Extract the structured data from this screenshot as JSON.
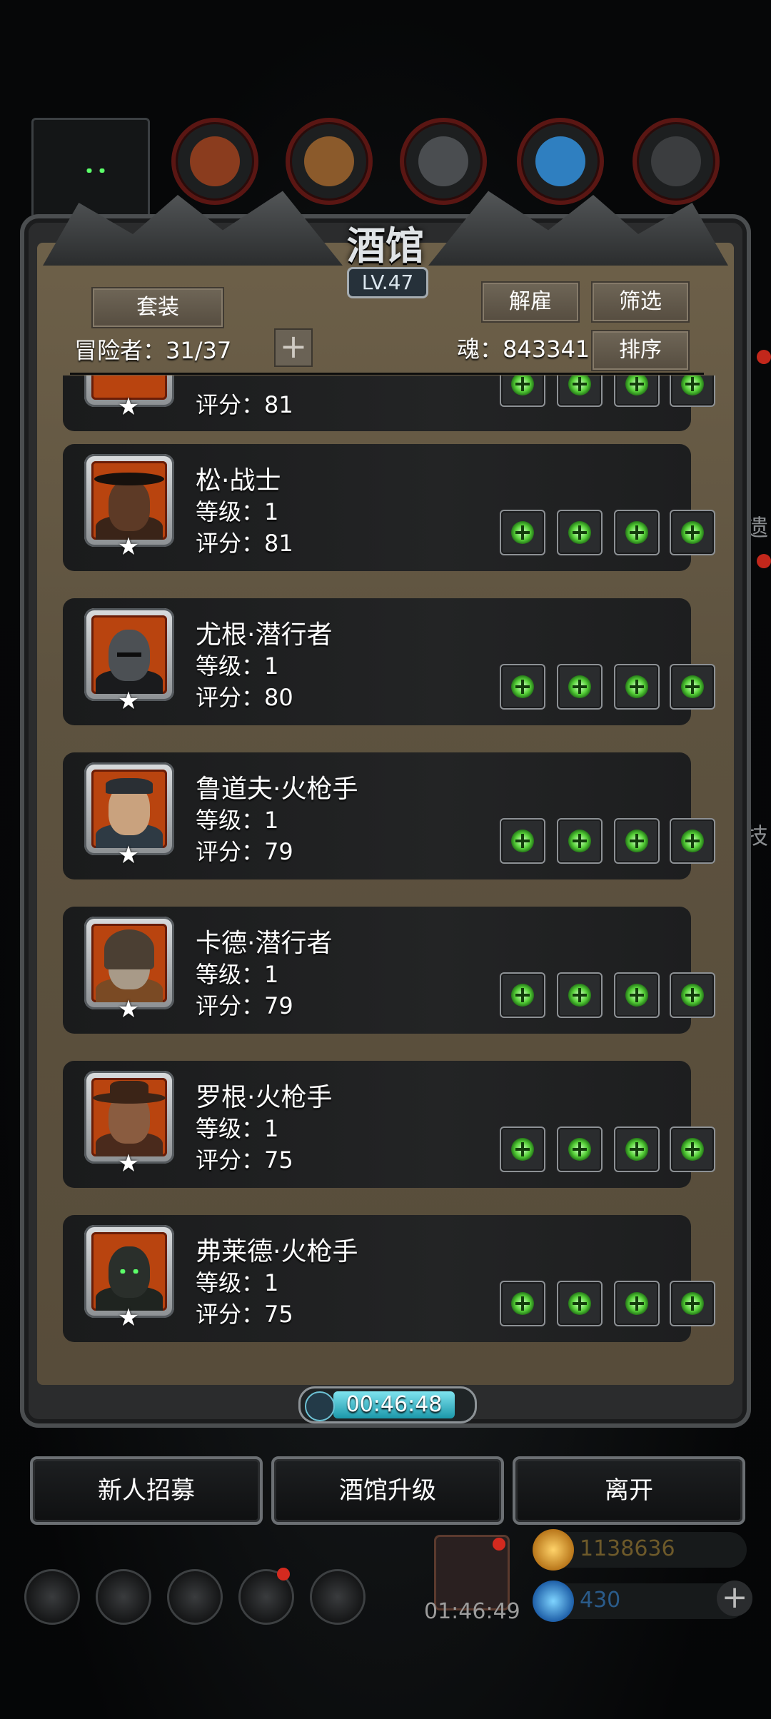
{
  "title": "酒馆",
  "level": "LV.47",
  "buttons": {
    "outfit": "套装",
    "dismiss": "解雇",
    "filter": "筛选",
    "sort": "排序",
    "recruit": "新人招募",
    "upgrade": "酒馆升级",
    "leave": "离开"
  },
  "header": {
    "adventurers": "冒险者：31/37",
    "soul": "魂：843341"
  },
  "timer": "00:46:48",
  "gift_timer": "01:46:49",
  "resources": {
    "gold": "1138636",
    "gems": "430"
  },
  "side_fragments": {
    "a": "技",
    "b": "遗"
  },
  "list": [
    {
      "name": "",
      "level": "",
      "score": "评分：81",
      "portrait": "partial"
    },
    {
      "name": "松·战士",
      "level": "等级：1",
      "score": "评分：81",
      "portrait": "hat-warrior"
    },
    {
      "name": "尤根·潜行者",
      "level": "等级：1",
      "score": "评分：80",
      "portrait": "helmet-rogue"
    },
    {
      "name": "鲁道夫·火枪手",
      "level": "等级：1",
      "score": "评分：79",
      "portrait": "blond-gunner"
    },
    {
      "name": "卡德·潜行者",
      "level": "等级：1",
      "score": "评分：79",
      "portrait": "old-hood"
    },
    {
      "name": "罗根·火枪手",
      "level": "等级：1",
      "score": "评分：75",
      "portrait": "cowboy-gunner"
    },
    {
      "name": "弗莱德·火枪手",
      "level": "等级：1",
      "score": "评分：75",
      "portrait": "dark-hood"
    }
  ],
  "icons": [
    "hood-avatar-icon",
    "meat-resource-icon",
    "wood-resource-icon",
    "iron-resource-icon",
    "crystal-resource-icon",
    "stone-resource-icon",
    "settings-icon",
    "hero-icon",
    "castle-icon",
    "mail-icon",
    "map-icon",
    "gift-icon",
    "gold-coin-icon",
    "gem-icon"
  ],
  "colors": {
    "panel": "#5d523f",
    "card": "#1f2021",
    "slot-green": "#58d23a",
    "portrait-frame": "#b9440f"
  }
}
